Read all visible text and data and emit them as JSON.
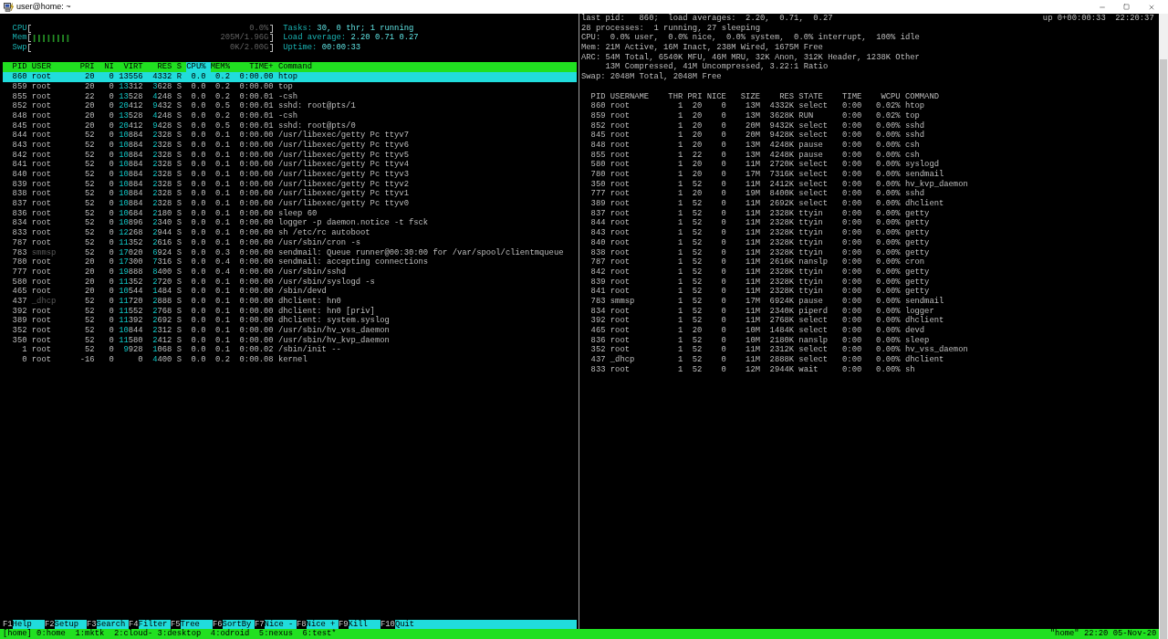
{
  "window": {
    "title": "user@home: ~"
  },
  "htop": {
    "meters": [
      {
        "label": "CPU",
        "value": "0.0%"
      },
      {
        "label": "Mem",
        "value": "205M/1.96G",
        "level": 0.16
      },
      {
        "label": "Swp",
        "value": "0K/2.00G"
      }
    ],
    "info": [
      {
        "label": "Tasks:",
        "value": "30, 0 thr; 1 running"
      },
      {
        "label": "Load average:",
        "value": "2.20 0.71 0.27"
      },
      {
        "label": "Uptime:",
        "value": "00:00:33"
      }
    ],
    "columns": [
      {
        "label": "PID",
        "sorted": false
      },
      {
        "label": "USER",
        "sorted": false
      },
      {
        "label": "PRI",
        "sorted": false
      },
      {
        "label": "NI",
        "sorted": false
      },
      {
        "label": "VIRT",
        "sorted": false
      },
      {
        "label": "RES",
        "sorted": false
      },
      {
        "label": "S",
        "sorted": false
      },
      {
        "label": "CPU%",
        "sorted": true
      },
      {
        "label": "MEM%",
        "sorted": false
      },
      {
        "label": "TIME+",
        "sorted": false
      },
      {
        "label": "Command",
        "sorted": false
      }
    ],
    "rows": [
      {
        "cells": [
          "860",
          "root",
          "20",
          "0",
          "13556",
          "4332",
          "R",
          "0.0",
          "0.2",
          "0:00.00",
          "htop"
        ],
        "selected": true,
        "shadowed": false
      },
      {
        "cells": [
          "859",
          "root",
          "20",
          "0",
          "13312",
          "3628",
          "S",
          "0.0",
          "0.2",
          "0:00.00",
          "top"
        ],
        "selected": false,
        "shadowed": false
      },
      {
        "cells": [
          "855",
          "root",
          "22",
          "0",
          "13528",
          "4248",
          "S",
          "0.0",
          "0.2",
          "0:00.01",
          "-csh"
        ],
        "selected": false,
        "shadowed": false
      },
      {
        "cells": [
          "852",
          "root",
          "20",
          "0",
          "20412",
          "9432",
          "S",
          "0.0",
          "0.5",
          "0:00.01",
          "sshd: root@pts/1"
        ],
        "selected": false,
        "shadowed": false
      },
      {
        "cells": [
          "848",
          "root",
          "20",
          "0",
          "13528",
          "4248",
          "S",
          "0.0",
          "0.2",
          "0:00.01",
          "-csh"
        ],
        "selected": false,
        "shadowed": false
      },
      {
        "cells": [
          "845",
          "root",
          "20",
          "0",
          "20412",
          "9428",
          "S",
          "0.0",
          "0.5",
          "0:00.01",
          "sshd: root@pts/0"
        ],
        "selected": false,
        "shadowed": false
      },
      {
        "cells": [
          "844",
          "root",
          "52",
          "0",
          "10884",
          "2328",
          "S",
          "0.0",
          "0.1",
          "0:00.00",
          "/usr/libexec/getty Pc ttyv7"
        ],
        "selected": false,
        "shadowed": false
      },
      {
        "cells": [
          "843",
          "root",
          "52",
          "0",
          "10884",
          "2328",
          "S",
          "0.0",
          "0.1",
          "0:00.00",
          "/usr/libexec/getty Pc ttyv6"
        ],
        "selected": false,
        "shadowed": false
      },
      {
        "cells": [
          "842",
          "root",
          "52",
          "0",
          "10884",
          "2328",
          "S",
          "0.0",
          "0.1",
          "0:00.00",
          "/usr/libexec/getty Pc ttyv5"
        ],
        "selected": false,
        "shadowed": false
      },
      {
        "cells": [
          "841",
          "root",
          "52",
          "0",
          "10884",
          "2328",
          "S",
          "0.0",
          "0.1",
          "0:00.00",
          "/usr/libexec/getty Pc ttyv4"
        ],
        "selected": false,
        "shadowed": false
      },
      {
        "cells": [
          "840",
          "root",
          "52",
          "0",
          "10884",
          "2328",
          "S",
          "0.0",
          "0.1",
          "0:00.00",
          "/usr/libexec/getty Pc ttyv3"
        ],
        "selected": false,
        "shadowed": false
      },
      {
        "cells": [
          "839",
          "root",
          "52",
          "0",
          "10884",
          "2328",
          "S",
          "0.0",
          "0.1",
          "0:00.00",
          "/usr/libexec/getty Pc ttyv2"
        ],
        "selected": false,
        "shadowed": false
      },
      {
        "cells": [
          "838",
          "root",
          "52",
          "0",
          "10884",
          "2328",
          "S",
          "0.0",
          "0.1",
          "0:00.00",
          "/usr/libexec/getty Pc ttyv1"
        ],
        "selected": false,
        "shadowed": false
      },
      {
        "cells": [
          "837",
          "root",
          "52",
          "0",
          "10884",
          "2328",
          "S",
          "0.0",
          "0.1",
          "0:00.00",
          "/usr/libexec/getty Pc ttyv0"
        ],
        "selected": false,
        "shadowed": false
      },
      {
        "cells": [
          "836",
          "root",
          "52",
          "0",
          "10684",
          "2180",
          "S",
          "0.0",
          "0.1",
          "0:00.00",
          "sleep 60"
        ],
        "selected": false,
        "shadowed": false
      },
      {
        "cells": [
          "834",
          "root",
          "52",
          "0",
          "10896",
          "2340",
          "S",
          "0.0",
          "0.1",
          "0:00.00",
          "logger -p daemon.notice -t fsck"
        ],
        "selected": false,
        "shadowed": false
      },
      {
        "cells": [
          "833",
          "root",
          "52",
          "0",
          "12268",
          "2944",
          "S",
          "0.0",
          "0.1",
          "0:00.00",
          "sh /etc/rc autoboot"
        ],
        "selected": false,
        "shadowed": false
      },
      {
        "cells": [
          "787",
          "root",
          "52",
          "0",
          "11352",
          "2616",
          "S",
          "0.0",
          "0.1",
          "0:00.00",
          "/usr/sbin/cron -s"
        ],
        "selected": false,
        "shadowed": false
      },
      {
        "cells": [
          "783",
          "smmsp",
          "52",
          "0",
          "17020",
          "6924",
          "S",
          "0.0",
          "0.3",
          "0:00.00",
          "sendmail: Queue runner@00:30:00 for /var/spool/clientmqueue"
        ],
        "selected": false,
        "shadowed": true
      },
      {
        "cells": [
          "780",
          "root",
          "20",
          "0",
          "17300",
          "7316",
          "S",
          "0.0",
          "0.4",
          "0:00.00",
          "sendmail: accepting connections"
        ],
        "selected": false,
        "shadowed": false
      },
      {
        "cells": [
          "777",
          "root",
          "20",
          "0",
          "19888",
          "8400",
          "S",
          "0.0",
          "0.4",
          "0:00.00",
          "/usr/sbin/sshd"
        ],
        "selected": false,
        "shadowed": false
      },
      {
        "cells": [
          "580",
          "root",
          "20",
          "0",
          "11352",
          "2720",
          "S",
          "0.0",
          "0.1",
          "0:00.00",
          "/usr/sbin/syslogd -s"
        ],
        "selected": false,
        "shadowed": false
      },
      {
        "cells": [
          "465",
          "root",
          "20",
          "0",
          "10544",
          "1484",
          "S",
          "0.0",
          "0.1",
          "0:00.00",
          "/sbin/devd"
        ],
        "selected": false,
        "shadowed": false
      },
      {
        "cells": [
          "437",
          "_dhcp",
          "52",
          "0",
          "11720",
          "2888",
          "S",
          "0.0",
          "0.1",
          "0:00.00",
          "dhclient: hn0"
        ],
        "selected": false,
        "shadowed": true
      },
      {
        "cells": [
          "392",
          "root",
          "52",
          "0",
          "11552",
          "2768",
          "S",
          "0.0",
          "0.1",
          "0:00.00",
          "dhclient: hn0 [priv]"
        ],
        "selected": false,
        "shadowed": false
      },
      {
        "cells": [
          "389",
          "root",
          "52",
          "0",
          "11392",
          "2692",
          "S",
          "0.0",
          "0.1",
          "0:00.00",
          "dhclient: system.syslog"
        ],
        "selected": false,
        "shadowed": false
      },
      {
        "cells": [
          "352",
          "root",
          "52",
          "0",
          "10844",
          "2312",
          "S",
          "0.0",
          "0.1",
          "0:00.00",
          "/usr/sbin/hv_vss_daemon"
        ],
        "selected": false,
        "shadowed": false
      },
      {
        "cells": [
          "350",
          "root",
          "52",
          "0",
          "11580",
          "2412",
          "S",
          "0.0",
          "0.1",
          "0:00.00",
          "/usr/sbin/hv_kvp_daemon"
        ],
        "selected": false,
        "shadowed": false
      },
      {
        "cells": [
          "1",
          "root",
          "52",
          "0",
          "9928",
          "1068",
          "S",
          "0.0",
          "0.1",
          "0:00.02",
          "/sbin/init --"
        ],
        "selected": false,
        "shadowed": false
      },
      {
        "cells": [
          "0",
          "root",
          "-16",
          "0",
          "0",
          "4400",
          "S",
          "0.0",
          "0.2",
          "0:00.08",
          "kernel"
        ],
        "selected": false,
        "shadowed": false
      }
    ],
    "function_keys": [
      {
        "key": "F1",
        "label": "Help"
      },
      {
        "key": "F2",
        "label": "Setup"
      },
      {
        "key": "F3",
        "label": "Search"
      },
      {
        "key": "F4",
        "label": "Filter"
      },
      {
        "key": "F5",
        "label": "Tree"
      },
      {
        "key": "F6",
        "label": "SortBy"
      },
      {
        "key": "F7",
        "label": "Nice -"
      },
      {
        "key": "F8",
        "label": "Nice +"
      },
      {
        "key": "F9",
        "label": "Kill"
      },
      {
        "key": "F10",
        "label": "Quit"
      }
    ]
  },
  "top": {
    "summary": "last pid:   860;  load averages:  2.20,  0.71,  0.27",
    "uptime": "up 0+00:00:33",
    "clock": "22:20:37",
    "lines": [
      {
        "text": "28 processes:  1 running, 27 sleeping"
      },
      {
        "text": "CPU:  0.0% user,  0.0% nice,  0.0% system,  0.0% interrupt,  100% idle"
      },
      {
        "text": "Mem: 21M Active, 16M Inact, 238M Wired, 1675M Free"
      },
      {
        "text": "ARC: 54M Total, 6540K MFU, 46M MRU, 32K Anon, 312K Header, 1238K Other",
        "continued": "13M Compressed, 41M Uncompressed, 3.22:1 Ratio"
      },
      {
        "text": "Swap: 2048M Total, 2048M Free"
      }
    ],
    "columns": [
      "PID",
      "USERNAME",
      "THR",
      "PRI",
      "NICE",
      "SIZE",
      "RES",
      "STATE",
      "TIME",
      "WCPU",
      "COMMAND"
    ],
    "rows": [
      [
        "860",
        "root",
        "1",
        "20",
        "0",
        "13M",
        "4332K",
        "select",
        "0:00",
        "0.02%",
        "htop"
      ],
      [
        "859",
        "root",
        "1",
        "20",
        "0",
        "13M",
        "3628K",
        "RUN",
        "0:00",
        "0.02%",
        "top"
      ],
      [
        "852",
        "root",
        "1",
        "20",
        "0",
        "20M",
        "9432K",
        "select",
        "0:00",
        "0.00%",
        "sshd"
      ],
      [
        "845",
        "root",
        "1",
        "20",
        "0",
        "20M",
        "9428K",
        "select",
        "0:00",
        "0.00%",
        "sshd"
      ],
      [
        "848",
        "root",
        "1",
        "20",
        "0",
        "13M",
        "4248K",
        "pause",
        "0:00",
        "0.00%",
        "csh"
      ],
      [
        "855",
        "root",
        "1",
        "22",
        "0",
        "13M",
        "4248K",
        "pause",
        "0:00",
        "0.00%",
        "csh"
      ],
      [
        "580",
        "root",
        "1",
        "20",
        "0",
        "11M",
        "2720K",
        "select",
        "0:00",
        "0.00%",
        "syslogd"
      ],
      [
        "780",
        "root",
        "1",
        "20",
        "0",
        "17M",
        "7316K",
        "select",
        "0:00",
        "0.00%",
        "sendmail"
      ],
      [
        "350",
        "root",
        "1",
        "52",
        "0",
        "11M",
        "2412K",
        "select",
        "0:00",
        "0.00%",
        "hv_kvp_daemon"
      ],
      [
        "777",
        "root",
        "1",
        "20",
        "0",
        "19M",
        "8400K",
        "select",
        "0:00",
        "0.00%",
        "sshd"
      ],
      [
        "389",
        "root",
        "1",
        "52",
        "0",
        "11M",
        "2692K",
        "select",
        "0:00",
        "0.00%",
        "dhclient"
      ],
      [
        "837",
        "root",
        "1",
        "52",
        "0",
        "11M",
        "2328K",
        "ttyin",
        "0:00",
        "0.00%",
        "getty"
      ],
      [
        "844",
        "root",
        "1",
        "52",
        "0",
        "11M",
        "2328K",
        "ttyin",
        "0:00",
        "0.00%",
        "getty"
      ],
      [
        "843",
        "root",
        "1",
        "52",
        "0",
        "11M",
        "2328K",
        "ttyin",
        "0:00",
        "0.00%",
        "getty"
      ],
      [
        "840",
        "root",
        "1",
        "52",
        "0",
        "11M",
        "2328K",
        "ttyin",
        "0:00",
        "0.00%",
        "getty"
      ],
      [
        "838",
        "root",
        "1",
        "52",
        "0",
        "11M",
        "2328K",
        "ttyin",
        "0:00",
        "0.00%",
        "getty"
      ],
      [
        "787",
        "root",
        "1",
        "52",
        "0",
        "11M",
        "2616K",
        "nanslp",
        "0:00",
        "0.00%",
        "cron"
      ],
      [
        "842",
        "root",
        "1",
        "52",
        "0",
        "11M",
        "2328K",
        "ttyin",
        "0:00",
        "0.00%",
        "getty"
      ],
      [
        "839",
        "root",
        "1",
        "52",
        "0",
        "11M",
        "2328K",
        "ttyin",
        "0:00",
        "0.00%",
        "getty"
      ],
      [
        "841",
        "root",
        "1",
        "52",
        "0",
        "11M",
        "2328K",
        "ttyin",
        "0:00",
        "0.00%",
        "getty"
      ],
      [
        "783",
        "smmsp",
        "1",
        "52",
        "0",
        "17M",
        "6924K",
        "pause",
        "0:00",
        "0.00%",
        "sendmail"
      ],
      [
        "834",
        "root",
        "1",
        "52",
        "0",
        "11M",
        "2340K",
        "piperd",
        "0:00",
        "0.00%",
        "logger"
      ],
      [
        "392",
        "root",
        "1",
        "52",
        "0",
        "11M",
        "2768K",
        "select",
        "0:00",
        "0.00%",
        "dhclient"
      ],
      [
        "465",
        "root",
        "1",
        "20",
        "0",
        "10M",
        "1484K",
        "select",
        "0:00",
        "0.00%",
        "devd"
      ],
      [
        "836",
        "root",
        "1",
        "52",
        "0",
        "10M",
        "2180K",
        "nanslp",
        "0:00",
        "0.00%",
        "sleep"
      ],
      [
        "352",
        "root",
        "1",
        "52",
        "0",
        "11M",
        "2312K",
        "select",
        "0:00",
        "0.00%",
        "hv_vss_daemon"
      ],
      [
        "437",
        "_dhcp",
        "1",
        "52",
        "0",
        "11M",
        "2888K",
        "select",
        "0:00",
        "0.00%",
        "dhclient"
      ],
      [
        "833",
        "root",
        "1",
        "52",
        "0",
        "12M",
        "2944K",
        "wait",
        "0:00",
        "0.00%",
        "sh"
      ]
    ]
  },
  "tmux": {
    "session": "[home]",
    "windows": [
      {
        "name": "0:home"
      },
      {
        "name": "1:mktk"
      },
      {
        "name": "2:cloud",
        "flag": "-"
      },
      {
        "name": "3:desktop"
      },
      {
        "name": "4:odroid"
      },
      {
        "name": "5:nexus"
      },
      {
        "name": "6:test",
        "flag": "*"
      }
    ],
    "info": "\"home\" 22:20 05-Nov-20"
  }
}
